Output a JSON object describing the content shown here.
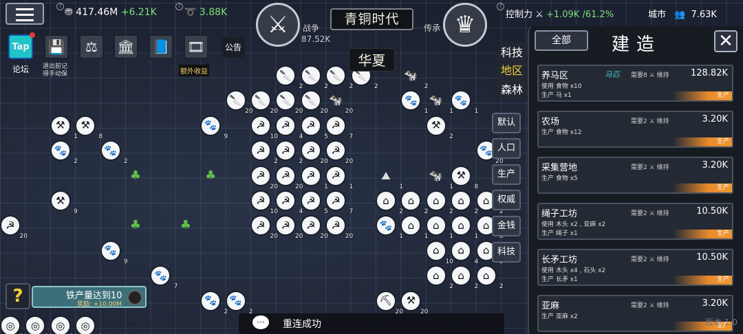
{
  "topbar": {
    "money": "417.46M",
    "money_rate": "+6.21K",
    "energy": "3.88K",
    "war_label": "战争",
    "war_value": "87.52K",
    "era": "青铜时代",
    "legacy_label": "传承",
    "control_label": "控制力",
    "control_rate": "+1.09K",
    "control_pct": "/61.2%",
    "city_label": "城市",
    "city_value": "7.63K"
  },
  "toolbar": {
    "tap": "Tap",
    "forum": "论坛",
    "save_hint": "退出前记得手动保",
    "extra_income": "额外收益",
    "notice": "公告"
  },
  "region": "华夏",
  "side_big": [
    "科技",
    "地区",
    "森林"
  ],
  "side_tabs": [
    "默认",
    "人口",
    "生产",
    "权威",
    "金钱",
    "科技"
  ],
  "panel": {
    "all": "全部",
    "title": "建造",
    "close": "✕",
    "cards": [
      {
        "name": "养马区",
        "sub": "马匹",
        "req": "需要8 ⚔ 维持",
        "value": "128.82K",
        "use": "使用  食物 x10",
        "prod": "生产  马 x1",
        "btn": "生产"
      },
      {
        "name": "农场",
        "sub": "",
        "req": "需要2 ⚔ 维持",
        "value": "3.20K",
        "use": "",
        "prod": "生产  食物 x12",
        "btn": "生产"
      },
      {
        "name": "采集营地",
        "sub": "",
        "req": "需要2 ⚔ 维持",
        "value": "3.20K",
        "use": "",
        "prod": "生产  食物 x5",
        "btn": "生产"
      },
      {
        "name": "绳子工坊",
        "sub": "",
        "req": "需要2 ⚔ 维持",
        "value": "10.50K",
        "use": "使用  木头 x2 , 亚麻 x2",
        "prod": "生产  绳子 x1",
        "btn": "生产"
      },
      {
        "name": "长矛工坊",
        "sub": "",
        "req": "需要2 ⚔ 维持",
        "value": "10.50K",
        "use": "使用  木头 x4 , 石头 x2",
        "prod": "生产  长矛 x1",
        "btn": "生产"
      },
      {
        "name": "亚麻",
        "sub": "",
        "req": "需要2 ⚔ 维持",
        "value": "3.20K",
        "use": "",
        "prod": "生产  亚麻 x2",
        "btn": "生产"
      }
    ]
  },
  "quest": {
    "title": "铁产量达到10",
    "reward": "奖励: +10.00M"
  },
  "toast": "重连成功",
  "version": "版本 1.0",
  "map": {
    "counts": [
      "2",
      "2",
      "2",
      "2",
      "2",
      "20",
      "20",
      "20",
      "20",
      "20",
      "1",
      "1",
      "1",
      "1",
      "8",
      "9",
      "10",
      "4",
      "5",
      "7"
    ]
  }
}
